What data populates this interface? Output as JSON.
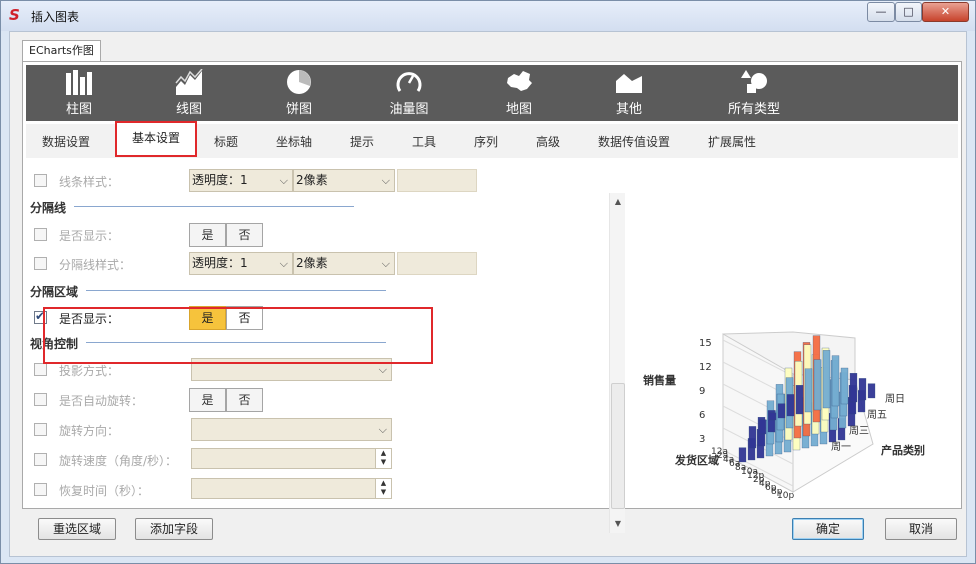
{
  "window": {
    "title": "插入图表",
    "controls": {
      "minimize": "—",
      "maximize": "□",
      "close": "✕"
    }
  },
  "tab": {
    "label": "ECharts作图"
  },
  "toolbar": [
    {
      "label": "柱图",
      "icon": "bar-chart-icon"
    },
    {
      "label": "线图",
      "icon": "area-line-chart-icon"
    },
    {
      "label": "饼图",
      "icon": "pie-chart-icon"
    },
    {
      "label": "油量图",
      "icon": "gauge-icon"
    },
    {
      "label": "地图",
      "icon": "china-map-icon"
    },
    {
      "label": "其他",
      "icon": "other-chart-icon"
    },
    {
      "label": "所有类型",
      "icon": "all-types-icon"
    }
  ],
  "subtabs": [
    "数据设置",
    "基本设置",
    "标题",
    "坐标轴",
    "提示",
    "工具",
    "序列",
    "高级",
    "数据传值设置",
    "扩展属性"
  ],
  "subtab_active": "基本设置",
  "form": {
    "line_style": {
      "label": "线条样式：",
      "opacity": "透明度：1",
      "width": "2像素"
    },
    "divider_section": "分隔线",
    "divider_show": {
      "label": "是否显示：",
      "yes": "是",
      "no": "否"
    },
    "divider_style": {
      "label": "分隔线样式：",
      "opacity": "透明度：1",
      "width": "2像素"
    },
    "area_section": "分隔区域",
    "area_show": {
      "label": "是否显示：",
      "yes": "是",
      "no": "否",
      "checked": true,
      "value": "是"
    },
    "view_section": "视角控制",
    "projection": {
      "label": "投影方式："
    },
    "auto_rotate": {
      "label": "是否自动旋转：",
      "yes": "是",
      "no": "否"
    },
    "rotate_dir": {
      "label": "旋转方向："
    },
    "rotate_speed": {
      "label": "旋转速度（角度/秒）："
    },
    "recover_time": {
      "label": "恢复时间（秒）："
    }
  },
  "chart_data": {
    "type": "bar3d",
    "zlabel": "销售量",
    "xlabel": "发货区域",
    "ylabel": "产品类别",
    "z_ticks": [
      "15",
      "12",
      "9",
      "6",
      "3"
    ],
    "y_ticks": [
      "周日",
      "周五",
      "周三",
      "周一"
    ],
    "x_ticks": [
      "12a",
      "2a",
      "4a",
      "6a",
      "8a",
      "10a",
      "12p",
      "2p",
      "4p",
      "6p",
      "8p",
      "10p"
    ],
    "colors": {
      "low": "#313695",
      "mid": "#74add1",
      "high_mid": "#ffffbf",
      "high": "#f46d43"
    }
  },
  "buttons": {
    "reselect": "重选区域",
    "add_field": "添加字段",
    "ok": "确定",
    "cancel": "取消"
  }
}
